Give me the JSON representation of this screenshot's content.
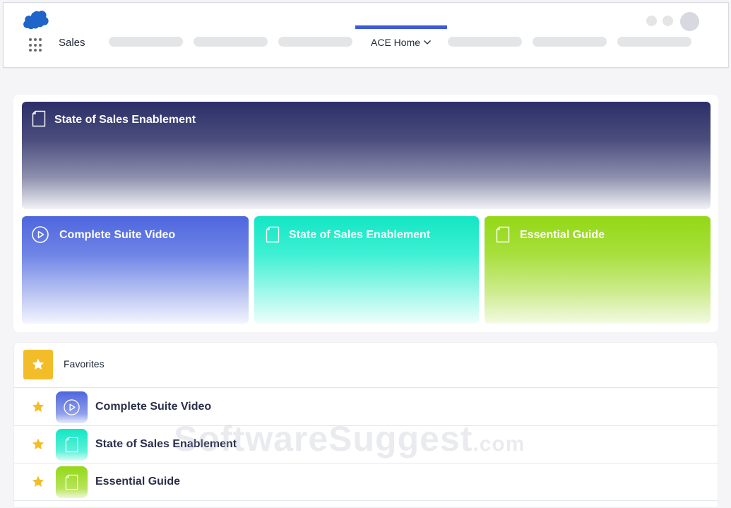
{
  "header": {
    "app_name": "Sales",
    "active_tab": "ACE Home",
    "accent_color": "#3d5bd8"
  },
  "hero": {
    "main_tile": {
      "title": "State of Sales Enablement",
      "icon": "document-icon"
    },
    "tiles": [
      {
        "title": "Complete Suite Video",
        "icon": "play-circle-icon",
        "color": "#4e66de"
      },
      {
        "title": "State of Sales Enablement",
        "icon": "document-icon",
        "color": "#12e6c4"
      },
      {
        "title": "Essential Guide",
        "icon": "document-icon",
        "color": "#93d816"
      }
    ]
  },
  "favorites": {
    "title": "Favorites",
    "badge_color": "#f3bd2a",
    "items": [
      {
        "label": "Complete Suite Video",
        "icon": "play-circle-icon"
      },
      {
        "label": "State of Sales Enablement",
        "icon": "document-icon"
      },
      {
        "label": "Essential Guide",
        "icon": "document-icon"
      }
    ]
  },
  "watermark": {
    "main": "SoftwareSuggest",
    "suffix": ".com"
  }
}
